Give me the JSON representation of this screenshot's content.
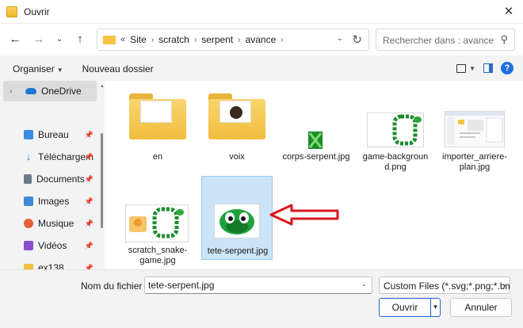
{
  "window": {
    "title": "Ouvrir"
  },
  "address": {
    "crumbs": [
      "Site",
      "scratch",
      "serpent",
      "avance"
    ],
    "prefix": "«"
  },
  "search": {
    "placeholder": "Rechercher dans : avance"
  },
  "toolbar": {
    "organize_label": "Organiser",
    "new_folder_label": "Nouveau dossier"
  },
  "sidebar": {
    "onedrive": "OneDrive",
    "items": [
      {
        "label": "Bureau",
        "icon": "desktop-icon",
        "color": "#3a8de0"
      },
      {
        "label": "Téléchargem",
        "icon": "download-icon",
        "color": "#1f7fd6"
      },
      {
        "label": "Documents",
        "icon": "documents-icon",
        "color": "#6b7a8c"
      },
      {
        "label": "Images",
        "icon": "images-icon",
        "color": "#3f8ad8"
      },
      {
        "label": "Musique",
        "icon": "music-icon",
        "color": "#e0603b"
      },
      {
        "label": "Vidéos",
        "icon": "videos-icon",
        "color": "#8a4fd0"
      },
      {
        "label": "ex138",
        "icon": "folder-icon",
        "color": "#f1bd3e"
      }
    ]
  },
  "files": [
    {
      "name": "en",
      "kind": "folder"
    },
    {
      "name": "voix",
      "kind": "folder"
    },
    {
      "name": "corps-serpent.jpg",
      "kind": "image"
    },
    {
      "name": "game-backgroun d.png",
      "kind": "image"
    },
    {
      "name": "importer_arriere-plan.jpg",
      "kind": "image"
    },
    {
      "name": "scratch_snake-game.jpg",
      "kind": "image"
    },
    {
      "name": "tete-serpent.jpg",
      "kind": "image",
      "selected": true
    }
  ],
  "bottom": {
    "filename_label": "Nom du fichier :",
    "filename_value": "tete-serpent.jpg",
    "filetype_value": "Custom Files (*.svg;*.png;*.bmp;",
    "open_label": "Ouvrir",
    "cancel_label": "Annuler"
  },
  "colors": {
    "accent": "#2062c9",
    "selection": "#cce4f7",
    "arrow": "#d9191c"
  }
}
